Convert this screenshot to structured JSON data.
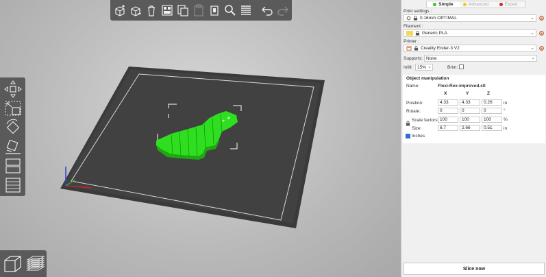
{
  "toolbar": {
    "items": [
      "add-object",
      "delete",
      "delete-all",
      "arrange",
      "copy",
      "paste",
      "add-instance",
      "remove-instance",
      "split",
      "search",
      "layers-editing",
      "undo",
      "redo"
    ]
  },
  "left_toolbar": {
    "items": [
      "move",
      "scale",
      "rotate",
      "place-on-face",
      "cut",
      "variable-layer-height"
    ]
  },
  "view_toggle": {
    "items": [
      "3d-view",
      "preview-view"
    ]
  },
  "mode": {
    "simple": "Simple",
    "advanced": "Advanced",
    "expert": "Expert",
    "colors": {
      "simple": "#3fbf2f",
      "advanced": "#f2c81e",
      "expert": "#d02626"
    }
  },
  "print_settings": {
    "label": "Print settings :",
    "value": "0.16mm OPTIMAL"
  },
  "filament": {
    "label": "Filament :",
    "value": "Generic PLA",
    "color": "#f2d75a"
  },
  "printer": {
    "label": "Printer :",
    "value": "Creality Ender-3 V2"
  },
  "supports": {
    "label": "Supports:",
    "value": "None"
  },
  "infill": {
    "label": "Infill:",
    "value": "15%"
  },
  "brim": {
    "label": "Brim:"
  },
  "object_manipulation": {
    "title": "Object manipulation",
    "name_label": "Name:",
    "name_value": "Flexi-Rex-improved.stl",
    "headers": [
      "X",
      "Y",
      "Z"
    ],
    "position": {
      "label": "Position:",
      "values": [
        "4.33",
        "4.33",
        "0.26"
      ],
      "unit": "in"
    },
    "rotate": {
      "label": "Rotate:",
      "values": [
        "0",
        "0",
        "0"
      ],
      "unit": "°"
    },
    "scale": {
      "label": "Scale factors:",
      "values": [
        "100",
        "100",
        "100"
      ],
      "unit": "%"
    },
    "size": {
      "label": "Size:",
      "values": [
        "6.7",
        "2.66",
        "0.51"
      ],
      "unit": "in"
    },
    "inches_label": "Inches"
  },
  "slice_button": "Slice now",
  "colors": {
    "model_green": "#2fdf1f",
    "bed": "#3a3a3a",
    "panel_bg": "#f0f0f0",
    "toolbar_bg": "#5a5a5a"
  }
}
